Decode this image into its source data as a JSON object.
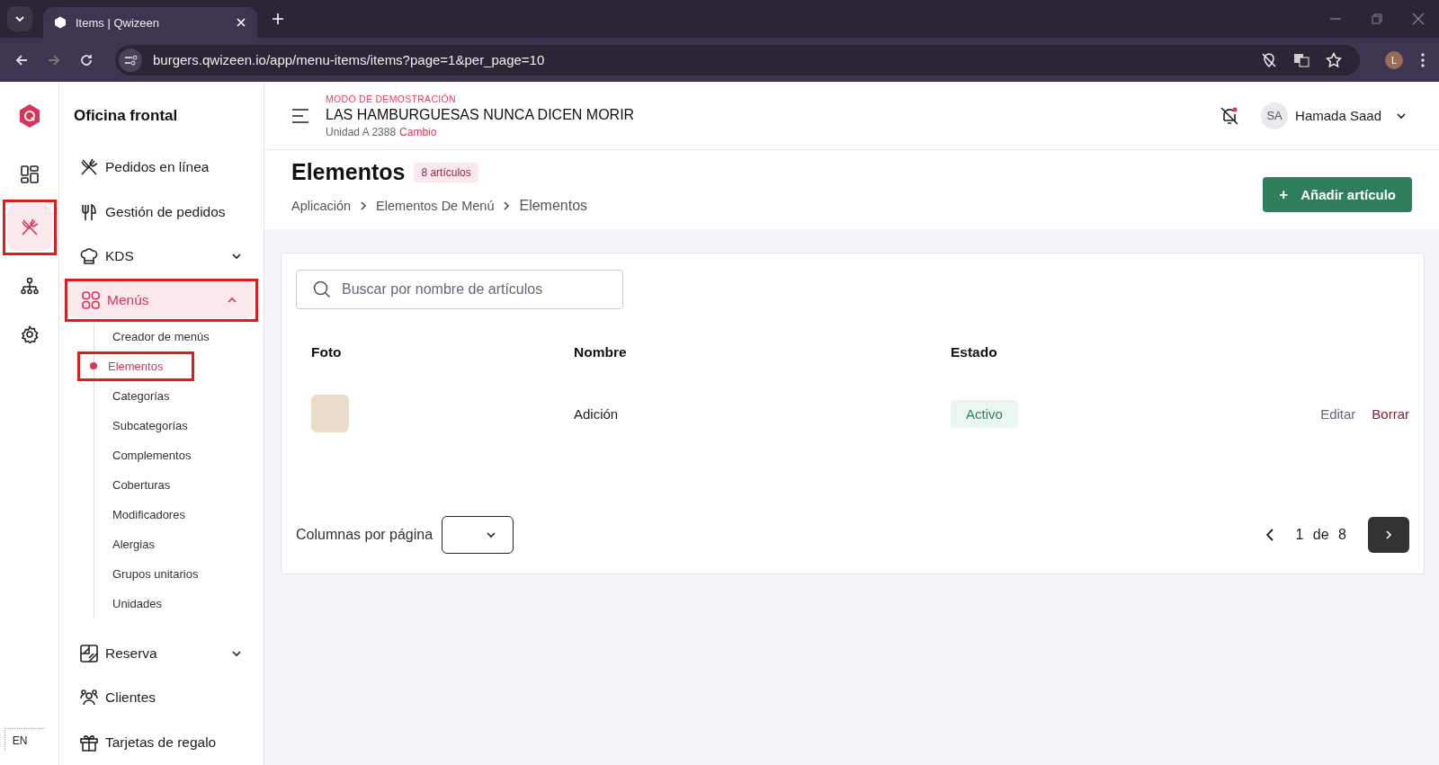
{
  "browser": {
    "tabs": [
      {
        "title": "Items | Qwizeen",
        "selected": true
      }
    ],
    "url": "burgers.qwizeen.io/app/menu-items/items?page=1&per_page=10",
    "profile_initial": "L"
  },
  "rail": {
    "items": [
      {
        "selected": false,
        "highlighted": false
      },
      {
        "selected": true,
        "highlighted": true
      },
      {
        "selected": false,
        "highlighted": false
      },
      {
        "selected": false,
        "highlighted": false
      }
    ],
    "language": "EN"
  },
  "sidebar": {
    "title": "Oficina frontal",
    "items": [
      {
        "label": "Pedidos en línea",
        "selected": false,
        "highlighted": false
      },
      {
        "label": "Gestión de pedidos",
        "selected": false,
        "highlighted": false
      },
      {
        "label": "KDS",
        "selected": false,
        "highlighted": false,
        "expanded": false
      },
      {
        "label": "Menús",
        "selected": true,
        "highlighted": true,
        "expanded": true,
        "children": [
          {
            "label": "Creador de menús",
            "selected": false,
            "highlighted": false
          },
          {
            "label": "Elementos",
            "selected": true,
            "highlighted": true
          },
          {
            "label": "Categorías",
            "selected": false,
            "highlighted": false
          },
          {
            "label": "Subcategorías",
            "selected": false,
            "highlighted": false
          },
          {
            "label": "Complementos",
            "selected": false,
            "highlighted": false
          },
          {
            "label": "Coberturas",
            "selected": false,
            "highlighted": false
          },
          {
            "label": "Modificadores",
            "selected": false,
            "highlighted": false
          },
          {
            "label": "Alergias",
            "selected": false,
            "highlighted": false
          },
          {
            "label": "Grupos unitarios",
            "selected": false,
            "highlighted": false
          },
          {
            "label": "Unidades",
            "selected": false,
            "highlighted": false
          }
        ]
      },
      {
        "label": "Reserva",
        "selected": false,
        "highlighted": false,
        "expanded": false
      },
      {
        "label": "Clientes",
        "selected": false,
        "highlighted": false
      },
      {
        "label": "Tarjetas de regalo",
        "selected": false,
        "highlighted": false
      }
    ]
  },
  "header": {
    "demo_label": "MODO DE DEMOSTRACIÓN",
    "restaurant": "LAS HAMBURGUESAS NUNCA DICEN MORIR",
    "unit": "Unidad A 2388",
    "change_link": "Cambio",
    "user": {
      "initials": "SA",
      "name": "Hamada Saad"
    }
  },
  "page": {
    "title": "Elementos",
    "count_badge": "8 artículos",
    "breadcrumbs": [
      "Aplicación",
      "Elementos De Menú",
      "Elementos"
    ],
    "add_button": {
      "icon": "+",
      "label": "Añadir artículo"
    }
  },
  "search": {
    "placeholder": "Buscar por nombre de artículos"
  },
  "table": {
    "columns": [
      "Foto",
      "Nombre",
      "Estado"
    ],
    "rows": [
      {
        "name": "Adición",
        "status": "Activo",
        "actions": [
          "Editar",
          "Borrar"
        ]
      }
    ]
  },
  "pagination": {
    "rows_label": "Columnas por página",
    "page_text": "1 de 8"
  }
}
